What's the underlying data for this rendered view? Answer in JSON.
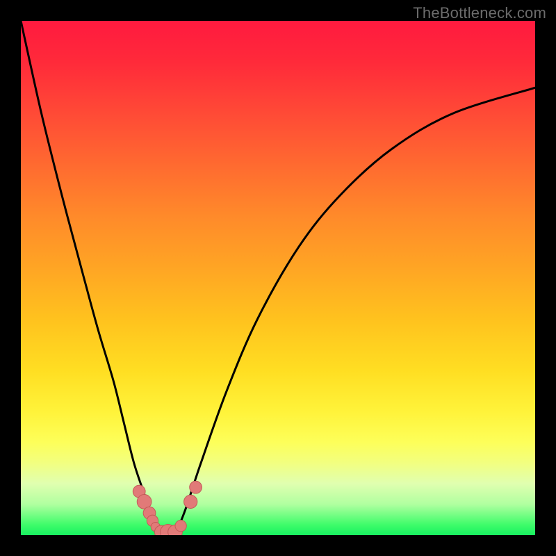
{
  "watermark": "TheBottleneck.com",
  "colors": {
    "frame": "#000000",
    "curve": "#000000",
    "spot_fill": "#e17a78",
    "spot_stroke": "#c45a58"
  },
  "chart_data": {
    "type": "line",
    "title": "",
    "xlabel": "",
    "ylabel": "",
    "xlim": [
      0,
      100
    ],
    "ylim": [
      0,
      100
    ],
    "grid": false,
    "series": [
      {
        "name": "left-curve",
        "x": [
          0,
          4,
          8,
          12,
          15,
          18,
          20,
          22,
          24,
          25,
          26,
          27
        ],
        "y": [
          100,
          82,
          66,
          51,
          40,
          30,
          22,
          14,
          8,
          5,
          2,
          0
        ]
      },
      {
        "name": "right-curve",
        "x": [
          30,
          32,
          35,
          40,
          46,
          54,
          62,
          72,
          84,
          100
        ],
        "y": [
          0,
          5,
          14,
          28,
          42,
          56,
          66,
          75,
          82,
          87
        ]
      },
      {
        "name": "valley-floor",
        "x": [
          27,
          28,
          29,
          30
        ],
        "y": [
          0,
          0,
          0,
          0
        ]
      }
    ],
    "annotations": {
      "salmon_spots": [
        {
          "x": 23.0,
          "y": 8.5,
          "r": 1.2
        },
        {
          "x": 24.0,
          "y": 6.5,
          "r": 1.4
        },
        {
          "x": 25.0,
          "y": 4.3,
          "r": 1.2
        },
        {
          "x": 25.6,
          "y": 2.8,
          "r": 1.1
        },
        {
          "x": 26.2,
          "y": 1.6,
          "r": 0.9
        },
        {
          "x": 27.3,
          "y": 0.6,
          "r": 1.3
        },
        {
          "x": 28.6,
          "y": 0.6,
          "r": 1.5
        },
        {
          "x": 30.0,
          "y": 0.6,
          "r": 1.4
        },
        {
          "x": 31.1,
          "y": 1.8,
          "r": 1.1
        },
        {
          "x": 33.0,
          "y": 6.5,
          "r": 1.3
        },
        {
          "x": 34.0,
          "y": 9.3,
          "r": 1.2
        }
      ]
    }
  }
}
